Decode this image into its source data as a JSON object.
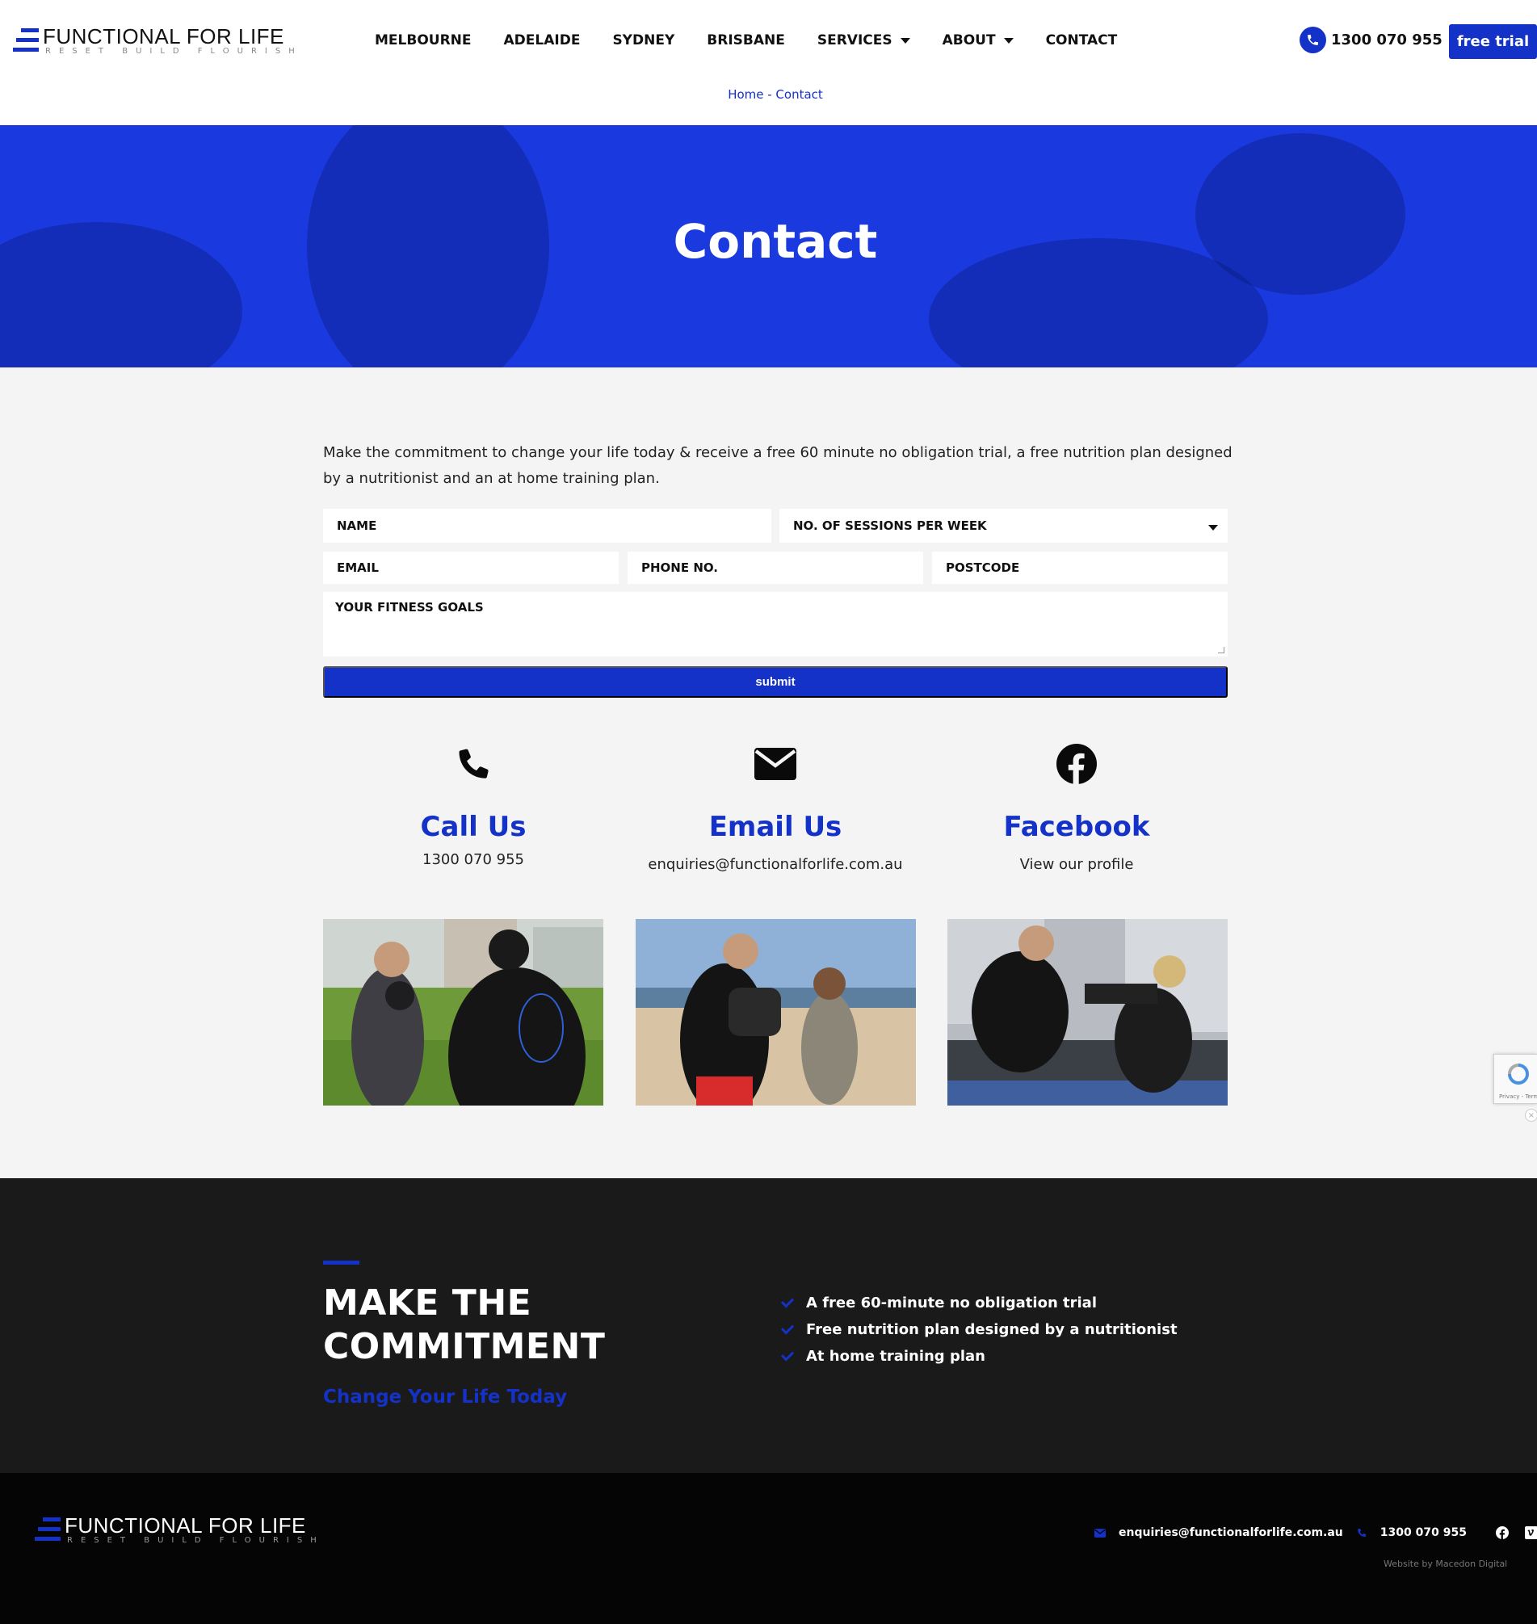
{
  "header": {
    "logo": {
      "name": "FUNCTIONAL FOR LIFE",
      "tagline": "RESET  BUILD  FLOURISH"
    },
    "nav": [
      {
        "label": "MELBOURNE",
        "dropdown": false
      },
      {
        "label": "ADELAIDE",
        "dropdown": false
      },
      {
        "label": "SYDNEY",
        "dropdown": false
      },
      {
        "label": "BRISBANE",
        "dropdown": false
      },
      {
        "label": "SERVICES",
        "dropdown": true
      },
      {
        "label": "ABOUT",
        "dropdown": true
      },
      {
        "label": "CONTACT",
        "dropdown": false
      }
    ],
    "phone": "1300 070 955",
    "cta_label": "free trial"
  },
  "breadcrumb": "Home - Contact",
  "hero": {
    "title": "Contact"
  },
  "form": {
    "intro": "Make the commitment to change your life today & receive a free 60 minute no obligation trial, a free nutrition plan designed by a nutritionist and an at home training plan.",
    "name_placeholder": "NAME",
    "sessions_placeholder": "NO. OF SESSIONS PER WEEK",
    "email_placeholder": "EMAIL",
    "phone_placeholder": "PHONE NO.",
    "postcode_placeholder": "POSTCODE",
    "goals_placeholder": "YOUR FITNESS GOALS",
    "submit_label": "submit"
  },
  "contact_methods": [
    {
      "icon": "phone-icon",
      "title": "Call Us",
      "detail": "1300 070 955"
    },
    {
      "icon": "envelope-icon",
      "title": "Email Us",
      "detail": "enquiries@functionalforlife.com.au"
    },
    {
      "icon": "facebook-icon",
      "title": "Facebook",
      "detail": "View our profile"
    }
  ],
  "recaptcha": {
    "text": "Privacy - Terms"
  },
  "commitment": {
    "title_line1": "MAKE THE",
    "title_line2": "COMMITMENT",
    "subtitle": "Change Your Life Today",
    "checklist": [
      "A free 60-minute no obligation trial",
      "Free nutrition plan designed by a nutritionist",
      "At home training plan"
    ]
  },
  "footer": {
    "logo": {
      "name": "FUNCTIONAL FOR LIFE",
      "tagline": "RESET  BUILD  FLOURISH"
    },
    "email": "enquiries@functionalforlife.com.au",
    "phone": "1300 070 955",
    "social": [
      "facebook-icon",
      "vimeo-icon"
    ],
    "credit": "Website by Macedon Digital"
  },
  "colors": {
    "brand_blue": "#1432c8",
    "hero_blue": "#1a3ae0",
    "dark_band": "#1a1a1a",
    "footer_black": "#050505",
    "page_grey": "#f4f4f4"
  }
}
